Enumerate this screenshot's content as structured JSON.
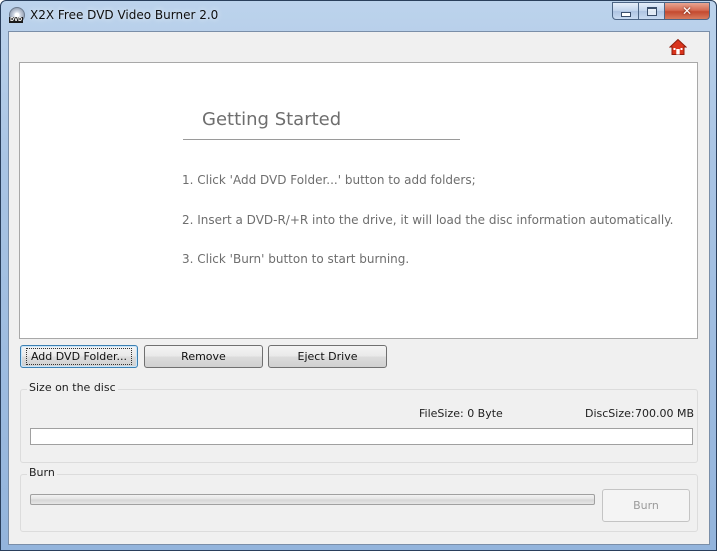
{
  "window": {
    "title": "X2X Free DVD Video Burner 2.0",
    "icon_label": "DVD",
    "controls": {
      "minimize": "minimize-icon",
      "maximize": "maximize-icon",
      "close": "close-icon"
    }
  },
  "header": {
    "home_icon": "home-icon"
  },
  "guide": {
    "title": "Getting Started",
    "steps": [
      "1. Click 'Add DVD Folder...' button to add folders;",
      "2. Insert a DVD-R/+R into the drive, it will load the disc information automatically.",
      "3. Click 'Burn' button to start burning."
    ]
  },
  "toolbar": {
    "add_label": "Add DVD Folder...",
    "remove_label": "Remove",
    "eject_label": "Eject Drive"
  },
  "size_group": {
    "title": "Size on the disc",
    "filesize_text": "FileSize: 0 Byte",
    "discsize_label": "DiscSize:",
    "discsize_value": "700.00 MB"
  },
  "burn_group": {
    "title": "Burn",
    "progress_fraction": 0,
    "burn_label": "Burn",
    "burn_enabled": false
  },
  "colors": {
    "accent": "#3c7fb1",
    "home_icon": "#d9341c",
    "guide_text": "#6e6e6e",
    "disabled_text": "#9b9b9b"
  }
}
